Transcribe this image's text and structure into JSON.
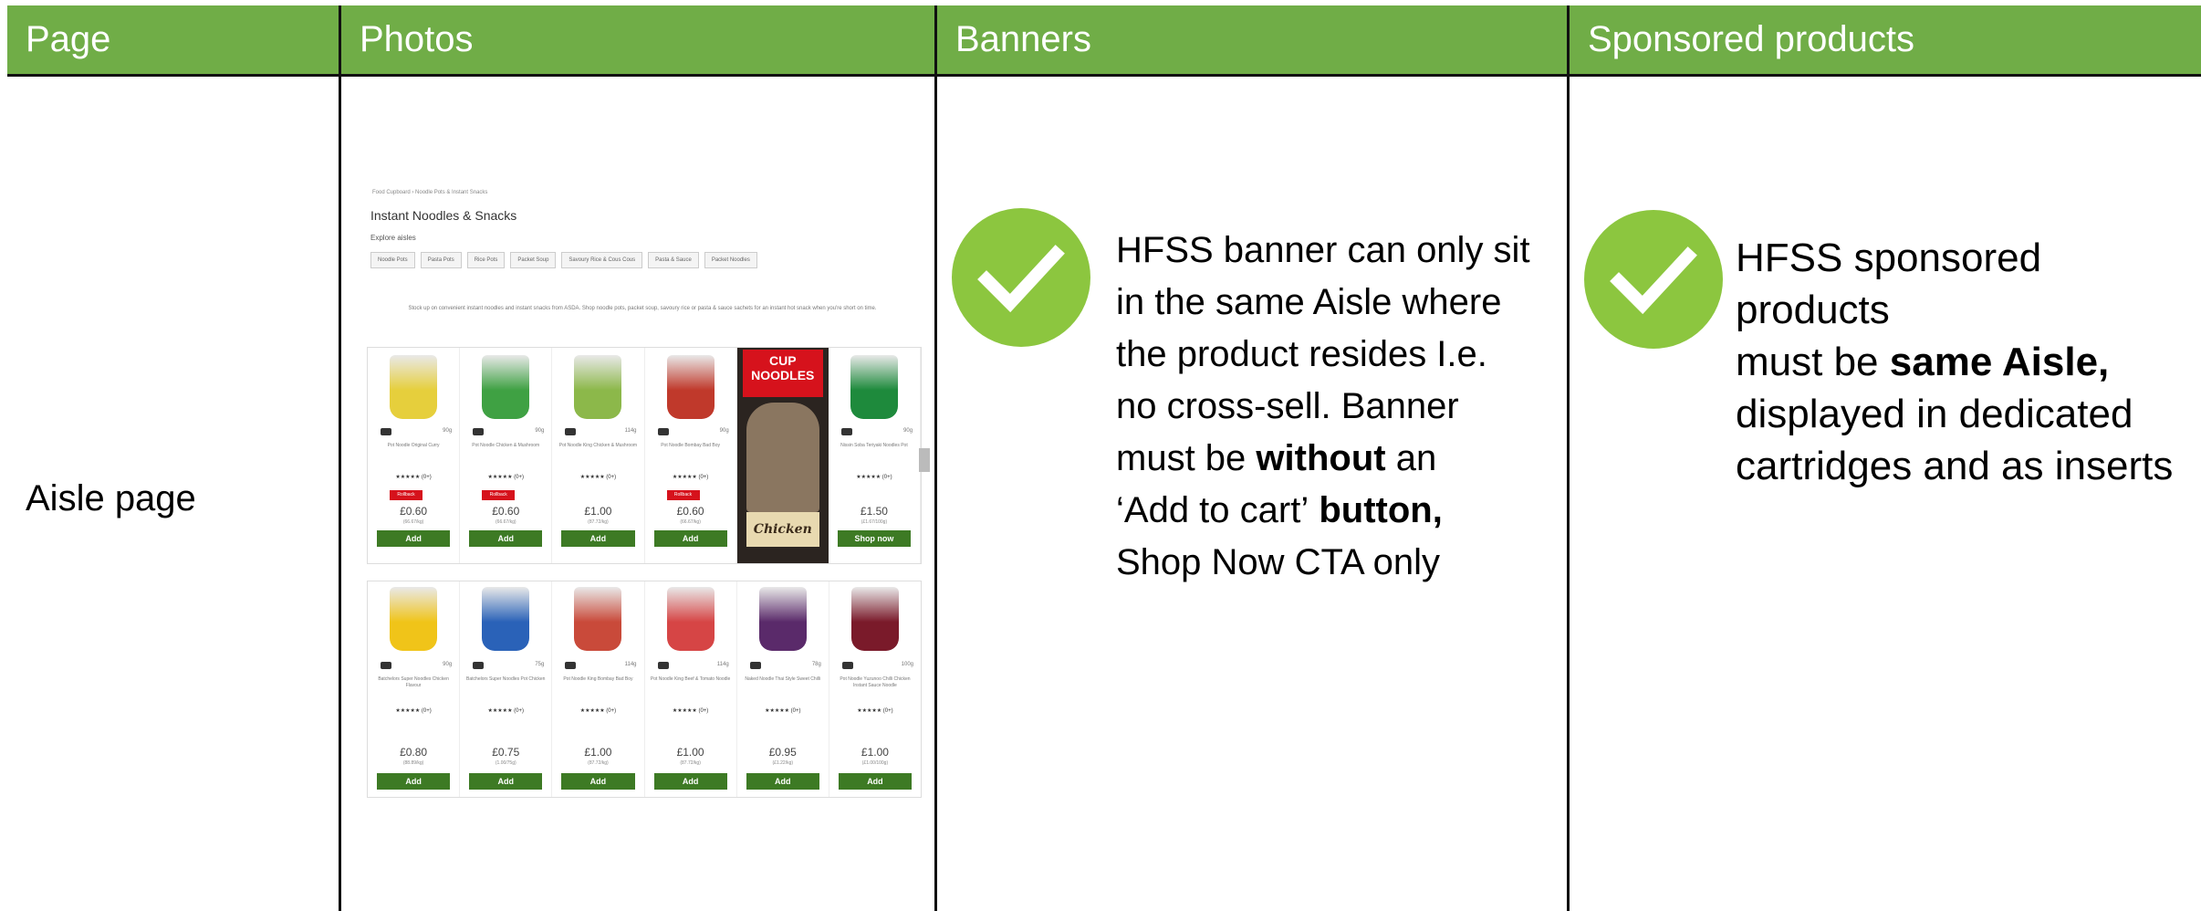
{
  "headers": [
    "Page",
    "Photos",
    "Banners",
    "Sponsored products"
  ],
  "row_label": "Aisle page",
  "banners": {
    "icon": "checkmark-icon",
    "lines": [
      [
        "HFSS banner can only sit"
      ],
      [
        "in the same Aisle where"
      ],
      [
        "the product resides I.e."
      ],
      [
        "no cross-sell. Banner"
      ],
      [
        "must be ",
        "without",
        " an"
      ],
      [
        "‘Add to cart’",
        " button,"
      ],
      [
        "Shop Now CTA only"
      ]
    ]
  },
  "sponsored": {
    "icon": "checkmark-icon",
    "lines": [
      [
        "HFSS sponsored products"
      ],
      [
        "must be ",
        "same Aisle,"
      ],
      [
        "displayed in dedicated"
      ],
      [
        "cartridges and as inserts"
      ]
    ]
  },
  "colors": {
    "header_bg": "#70ad47",
    "check_bg": "#8cc63f",
    "add_button": "#3d7a24"
  },
  "screenshot": {
    "breadcrumb": "Food Cupboard › Noodle Pots & Instant Snacks",
    "title": "Instant Noodles & Snacks",
    "explore_label": "Explore aisles",
    "pills": [
      "Noodle Pots",
      "Pasta Pots",
      "Rice Pots",
      "Packet Soup",
      "Savoury Rice & Cous Cous",
      "Pasta & Sauce",
      "Packet Noodles"
    ],
    "blurb": "Stock up on convenient instant noodles and instant snacks from ASDA. Shop noodle pots, packet soup, savoury rice or pasta & sauce sachets for an instant hot snack when you're short on time.",
    "row1": [
      {
        "name": "Pot Noodle Original Curry",
        "weight": "90g",
        "stars": "★★★★★ (0+)",
        "rollback": "Rollback",
        "price": "£0.60",
        "unit": "(66.67/kg)",
        "button": "Add",
        "color": "#e6cf3c"
      },
      {
        "name": "Pot Noodle Chicken & Mushroom",
        "weight": "90g",
        "stars": "★★★★★ (0+)",
        "rollback": "Rollback",
        "price": "£0.60",
        "unit": "(66.67/kg)",
        "button": "Add",
        "color": "#3fa143"
      },
      {
        "name": "Pot Noodle King Chicken & Mushroom",
        "weight": "114g",
        "stars": "★★★★★ (0+)",
        "rollback": "",
        "price": "£1.00",
        "unit": "(87.72/kg)",
        "button": "Add",
        "color": "#8cb84a"
      },
      {
        "name": "Pot Noodle Bombay Bad Boy",
        "weight": "90g",
        "stars": "★★★★★ (0+)",
        "rollback": "Rollback",
        "price": "£0.60",
        "unit": "(66.67/kg)",
        "button": "Add",
        "color": "#c0392b"
      },
      {
        "promo": true,
        "lid": "CUP NOODLES",
        "word": "Chicken"
      },
      {
        "name": "Nissin Soba Teriyaki Noodles Pot",
        "weight": "90g",
        "stars": "★★★★★ (0+)",
        "rollback": "",
        "price": "£1.50",
        "unit": "(£1.67/100g)",
        "button": "Shop now",
        "color": "#1e8a3c"
      }
    ],
    "row2": [
      {
        "name": "Batchelors Super Noodles Chicken Flavour",
        "weight": "90g",
        "stars": "★★★★★ (0+)",
        "price": "£0.80",
        "unit": "(88.89/kg)",
        "button": "Add",
        "color": "#f0c419"
      },
      {
        "name": "Batchelors Super Noodles Pot Chicken",
        "weight": "75g",
        "stars": "★★★★★ (0+)",
        "price": "£0.75",
        "unit": "(1.00/75g)",
        "button": "Add",
        "color": "#2a62b8"
      },
      {
        "name": "Pot Noodle King Bombay Bad Boy",
        "weight": "114g",
        "stars": "★★★★★ (0+)",
        "price": "£1.00",
        "unit": "(87.72/kg)",
        "button": "Add",
        "color": "#c94a3a"
      },
      {
        "name": "Pot Noodle King Beef & Tomato Noodle",
        "weight": "114g",
        "stars": "★★★★★ (0+)",
        "price": "£1.00",
        "unit": "(87.72/kg)",
        "button": "Add",
        "color": "#d64545"
      },
      {
        "name": "Naked Noodle Thai Style Sweet Chilli",
        "weight": "78g",
        "stars": "★★★★★ (0+)",
        "price": "£0.95",
        "unit": "(£1.22/kg)",
        "button": "Add",
        "color": "#5a2a6a"
      },
      {
        "name": "Pot Noodle Yuzunoo Chilli Chicken Instant Sauce Noodle",
        "weight": "100g",
        "stars": "★★★★★ (0+)",
        "price": "£1.00",
        "unit": "(£1.00/100g)",
        "button": "Add",
        "color": "#7a1a2a"
      }
    ]
  }
}
